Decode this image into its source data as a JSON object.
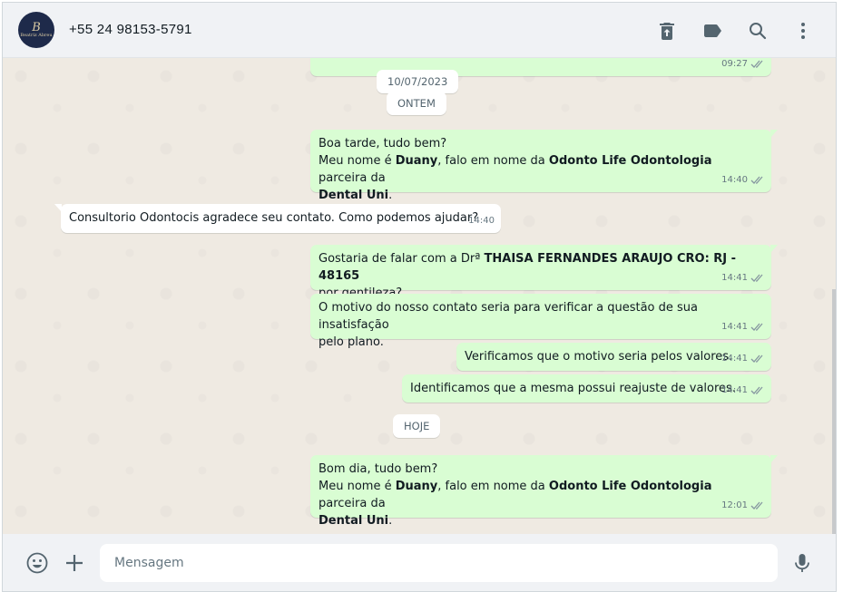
{
  "header": {
    "avatar_monogram": "B",
    "avatar_name": "Beatriz Abreu",
    "contact": "+55 24 98153-5791",
    "icons": [
      "delete-icon",
      "label-icon",
      "search-icon",
      "menu-icon"
    ]
  },
  "top_partial_time": "09:27",
  "dates": {
    "old": "10/07/2023",
    "yesterday": "ONTEM",
    "today": "HOJE"
  },
  "messages": [
    {
      "dir": "out",
      "l1": "Boa tarde, tudo bem?",
      "l2a": "Meu nome é ",
      "l2b": "Duany",
      "l2c": ", falo em nome da ",
      "l2d": "Odonto Life Odontologia",
      "l2e": " parceira da",
      "l3": "Dental Uni",
      "l3b": ".",
      "time": "14:40"
    },
    {
      "dir": "in",
      "text": "Consultorio Odontocis agradece seu contato. Como podemos ajudar?",
      "time": "14:40"
    },
    {
      "dir": "out",
      "l1a": "Gostaria de falar com a Drª ",
      "l1b": "THAISA FERNANDES ARAUJO CRO: RJ - 48165",
      "l2": "por gentileza?",
      "time": "14:41"
    },
    {
      "dir": "out",
      "l1": "O motivo do nosso contato seria para verificar a questão de sua insatisfação",
      "l2": "pelo plano.",
      "time": "14:41"
    },
    {
      "dir": "out",
      "text": "Verificamos que o motivo seria pelos valores.",
      "time": "14:41"
    },
    {
      "dir": "out",
      "text": "Identificamos que a mesma possui reajuste de valores.",
      "time": "14:41"
    },
    {
      "dir": "out",
      "l1": "Bom dia, tudo bem?",
      "l2a": "Meu nome é ",
      "l2b": "Duany",
      "l2c": ", falo em nome da ",
      "l2d": "Odonto Life Odontologia",
      "l2e": " parceira da",
      "l3": "Dental Uni",
      "l3b": ".",
      "time": "12:01"
    }
  ],
  "footer": {
    "placeholder": "Mensagem",
    "icons": [
      "emoji-icon",
      "attach-plus-icon",
      "microphone-icon"
    ]
  },
  "colors": {
    "outgoing": "#d9fdd3",
    "incoming": "#ffffff",
    "background": "#efeae2",
    "read_ticks": "#53bdeb"
  }
}
